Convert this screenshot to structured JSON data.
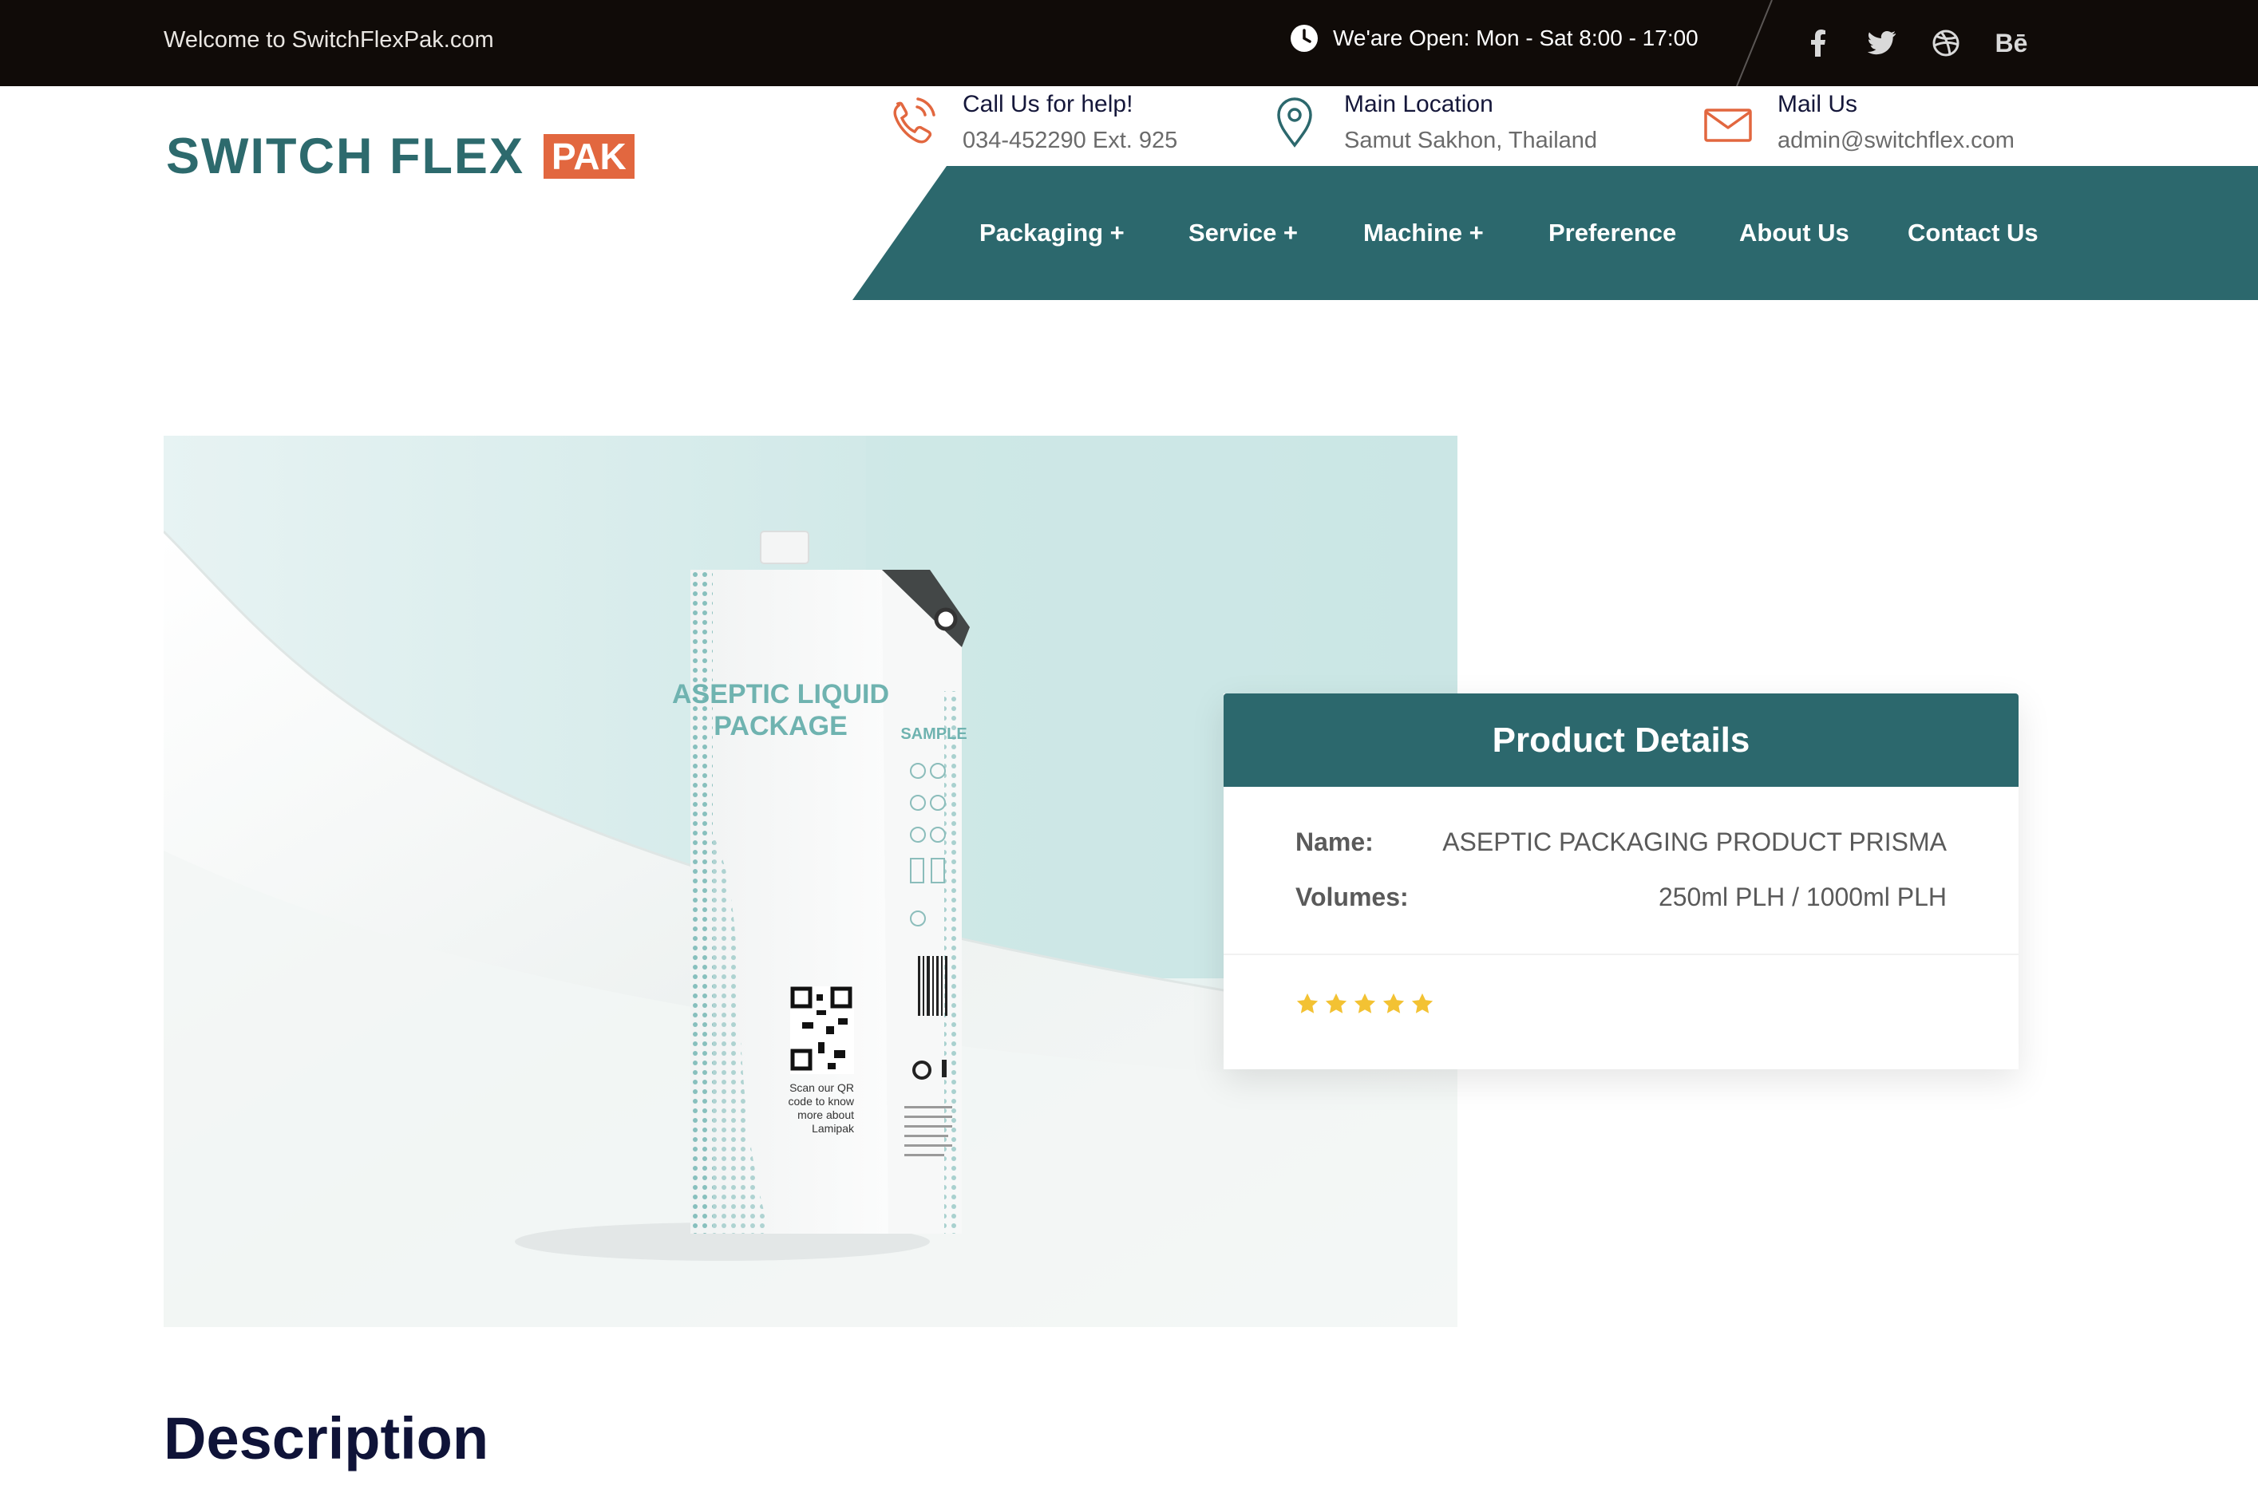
{
  "topbar": {
    "welcome": "Welcome to SwitchFlexPak.com",
    "hours": "We'are Open: Mon - Sat 8:00 - 17:00",
    "hours_icon": "clock-icon",
    "social": [
      "facebook-icon",
      "twitter-icon",
      "dribbble-icon",
      "behance-icon"
    ],
    "behance_label": "Bē"
  },
  "header": {
    "logo_text": "SWITCH FLEX",
    "logo_tag": "PAK",
    "contacts": [
      {
        "icon": "phone-icon",
        "title": "Call Us for help!",
        "value": "034-452290 Ext. 925"
      },
      {
        "icon": "location-pin-icon",
        "title": "Main Location",
        "value": "Samut Sakhon, Thailand"
      },
      {
        "icon": "mail-icon",
        "title": "Mail Us",
        "value": "admin@switchflex.com"
      }
    ]
  },
  "nav": {
    "items": [
      {
        "label": "Packaging +"
      },
      {
        "label": "Service +"
      },
      {
        "label": "Machine +"
      },
      {
        "label": "Preference"
      },
      {
        "label": "About Us"
      },
      {
        "label": "Contact Us"
      }
    ]
  },
  "product_image": {
    "carton_title_line1": "ASEPTIC LIQUID",
    "carton_title_line2": "PACKAGE",
    "carton_sample": "SAMPLE",
    "carton_qr_text": "Scan our QR code to know more about Lamipak"
  },
  "product_details": {
    "heading": "Product Details",
    "name_label": "Name:",
    "name_value": "ASEPTIC PACKAGING PRODUCT PRISMA",
    "volumes_label": "Volumes:",
    "volumes_value": "250ml PLH / 1000ml PLH",
    "rating": 5,
    "rating_max": 5
  },
  "description": {
    "heading": "Description"
  },
  "colors": {
    "topbar": "#100b08",
    "teal": "#2c686d",
    "accent_orange": "#e2673f",
    "star": "#f3c233",
    "heading_dark": "#0f1338"
  }
}
